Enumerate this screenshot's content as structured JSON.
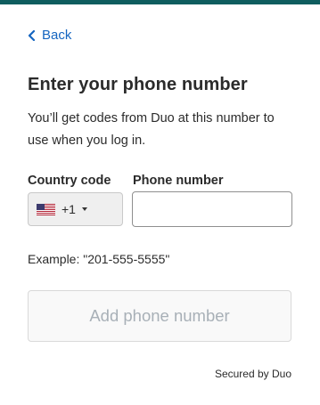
{
  "colors": {
    "top_bar": "#0f5d5f",
    "link": "#1565c0",
    "disabled_text": "#a8b0b7"
  },
  "nav": {
    "back_label": "Back",
    "back_icon": "chevron-left-icon"
  },
  "header": {
    "title": "Enter your phone number",
    "subtitle": "You’ll get codes from Duo at this number to use when you log in."
  },
  "form": {
    "country_code": {
      "label": "Country code",
      "selected_flag": "us-flag-icon",
      "selected_value": "+1",
      "dropdown_icon": "caret-down-icon"
    },
    "phone_number": {
      "label": "Phone number",
      "value": "",
      "placeholder": ""
    },
    "example": "Example: \"201-555-5555\"",
    "submit_label": "Add phone number"
  },
  "footer": {
    "secured_text": "Secured by Duo"
  }
}
